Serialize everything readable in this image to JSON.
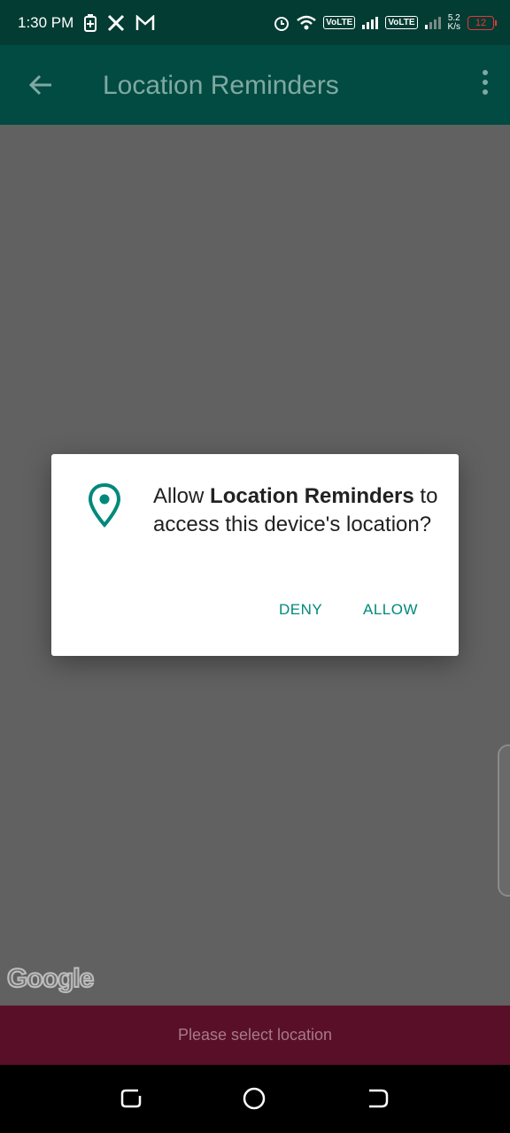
{
  "status_bar": {
    "time": "1:30 PM",
    "volte1": "VoLTE",
    "volte2": "VoLTE",
    "net_speed_value": "5.2",
    "net_speed_unit": "K/s",
    "battery": "12",
    "icons": [
      "battery-saver-icon",
      "x-app-icon",
      "gmail-icon",
      "alarm-icon",
      "wifi-icon",
      "signal-icon"
    ]
  },
  "app_bar": {
    "title": "Location Reminders"
  },
  "dialog": {
    "prefix": "Allow ",
    "app_name": "Location Reminders",
    "suffix": " to access this device's location?",
    "deny_label": "DENY",
    "allow_label": "ALLOW",
    "accent": "#00897b"
  },
  "map": {
    "logo_text": "Google"
  },
  "snackbar": {
    "text": "Please select location"
  },
  "colors": {
    "status_bar": "#023c33",
    "app_bar": "#024b42",
    "scrim": "#616161",
    "snackbar": "#5a0f29"
  }
}
